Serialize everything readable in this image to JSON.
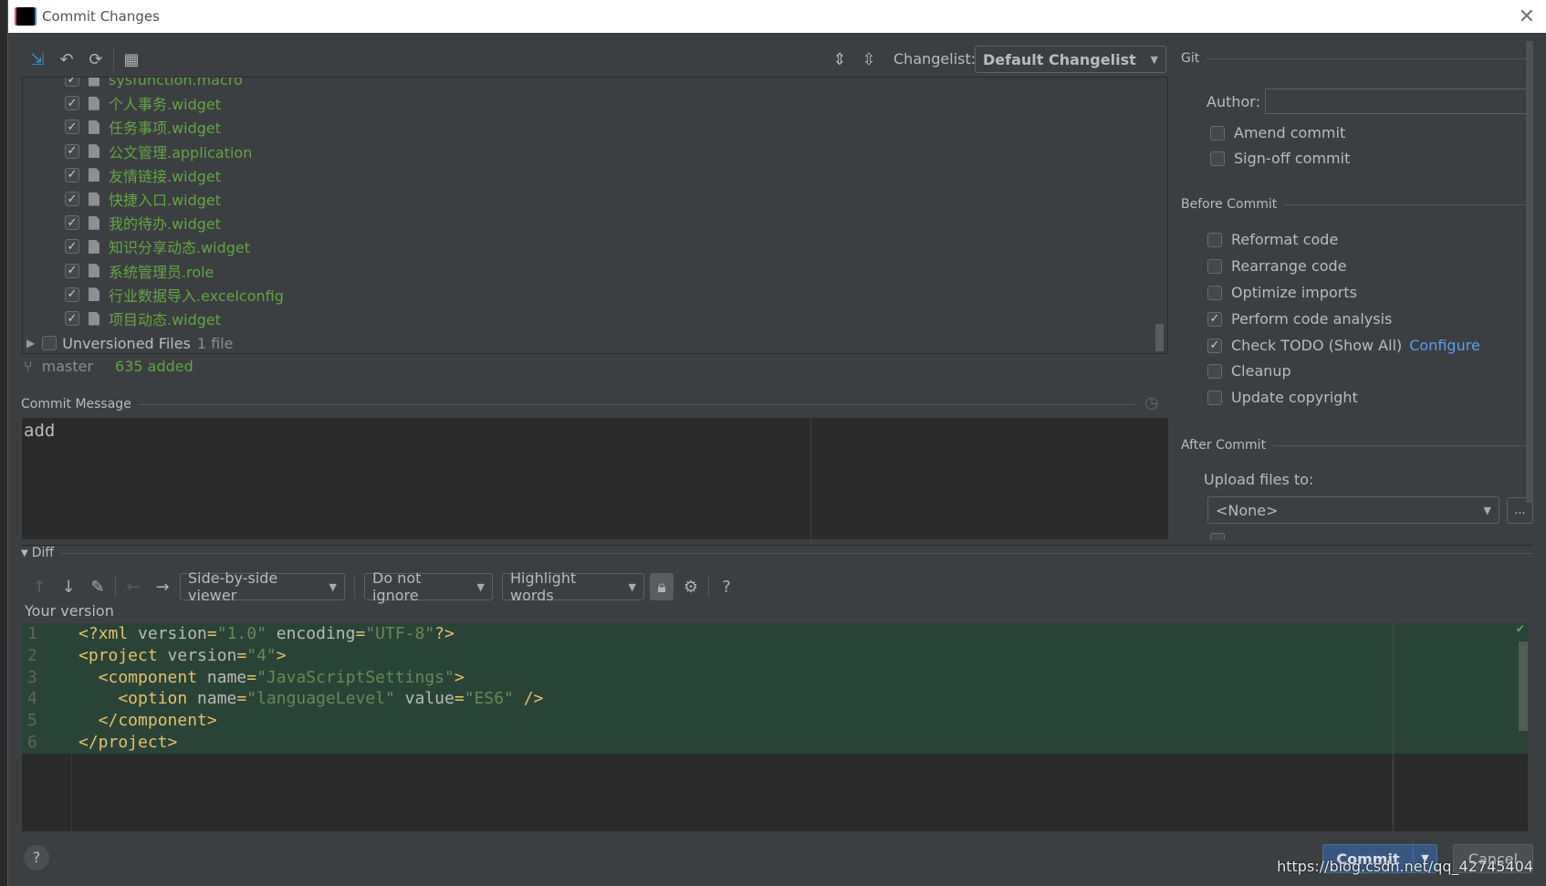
{
  "window": {
    "title": "Commit Changes",
    "logo_text": "IJ"
  },
  "toolbar": {
    "changelist_label": "Changelist:",
    "changelist_value": "Default Changelist"
  },
  "files": [
    {
      "name": "sysfunction.macro",
      "checked": true
    },
    {
      "name": "个人事务.widget",
      "checked": true
    },
    {
      "name": "任务事项.widget",
      "checked": true
    },
    {
      "name": "公文管理.application",
      "checked": true
    },
    {
      "name": "友情链接.widget",
      "checked": true
    },
    {
      "name": "快捷入口.widget",
      "checked": true
    },
    {
      "name": "我的待办.widget",
      "checked": true
    },
    {
      "name": "知识分享动态.widget",
      "checked": true
    },
    {
      "name": "系统管理员.role",
      "checked": true
    },
    {
      "name": "行业数据导入.excelconfig",
      "checked": true
    },
    {
      "name": "项目动态.widget",
      "checked": true
    }
  ],
  "unversioned": {
    "label": "Unversioned Files",
    "count": "1 file"
  },
  "status": {
    "branch": "master",
    "added": "635 added"
  },
  "commit_message": {
    "label": "Commit Message",
    "value": "add"
  },
  "git": {
    "section": "Git",
    "author_label": "Author:",
    "author_value": "",
    "amend": "Amend commit",
    "signoff": "Sign-off commit"
  },
  "before_commit": {
    "section": "Before Commit",
    "options": [
      {
        "label": "Reformat code",
        "checked": false
      },
      {
        "label": "Rearrange code",
        "checked": false
      },
      {
        "label": "Optimize imports",
        "checked": false
      },
      {
        "label": "Perform code analysis",
        "checked": true
      },
      {
        "label": "Check TODO (Show All)",
        "checked": true,
        "link": "Configure"
      },
      {
        "label": "Cleanup",
        "checked": false
      },
      {
        "label": "Update copyright",
        "checked": false
      }
    ]
  },
  "after_commit": {
    "section": "After Commit",
    "upload_label": "Upload files to:",
    "upload_value": "<None>",
    "more": "..."
  },
  "diff": {
    "label": "Diff",
    "viewer": "Side-by-side viewer",
    "ignore": "Do not ignore",
    "highlight": "Highlight words",
    "help": "?",
    "version_label": "Your version",
    "lines": [
      {
        "n": "1",
        "parts": [
          [
            "tag",
            "<?xml "
          ],
          [
            "attr",
            "version"
          ],
          [
            "tag",
            "="
          ],
          [
            "val",
            "\"1.0\""
          ],
          [
            "attr",
            " encoding"
          ],
          [
            "tag",
            "="
          ],
          [
            "val",
            "\"UTF-8\""
          ],
          [
            "tag",
            "?>"
          ]
        ]
      },
      {
        "n": "2",
        "parts": [
          [
            "tag",
            "<project "
          ],
          [
            "attr",
            "version"
          ],
          [
            "tag",
            "="
          ],
          [
            "val",
            "\"4\""
          ],
          [
            "tag",
            ">"
          ]
        ]
      },
      {
        "n": "3",
        "parts": [
          [
            "tag",
            "  <component "
          ],
          [
            "attr",
            "name"
          ],
          [
            "tag",
            "="
          ],
          [
            "val",
            "\"JavaScriptSettings\""
          ],
          [
            "tag",
            ">"
          ]
        ]
      },
      {
        "n": "4",
        "parts": [
          [
            "tag",
            "    <option "
          ],
          [
            "attr",
            "name"
          ],
          [
            "tag",
            "="
          ],
          [
            "val",
            "\"languageLevel\""
          ],
          [
            "attr",
            " value"
          ],
          [
            "tag",
            "="
          ],
          [
            "val",
            "\"ES6\""
          ],
          [
            "tag",
            " />"
          ]
        ]
      },
      {
        "n": "5",
        "parts": [
          [
            "tag",
            "  </component>"
          ]
        ]
      },
      {
        "n": "6",
        "parts": [
          [
            "tag",
            "</project>"
          ]
        ]
      }
    ]
  },
  "buttons": {
    "commit": "Commit",
    "cancel": "Cancel",
    "help": "?"
  },
  "watermark": "https://blog.csdn.net/qq_42745404",
  "colors": {
    "bg": "#3c3f41",
    "added_file": "#62a543",
    "link": "#589df6",
    "commit_button": "#365880",
    "diff_added": "#294436"
  }
}
